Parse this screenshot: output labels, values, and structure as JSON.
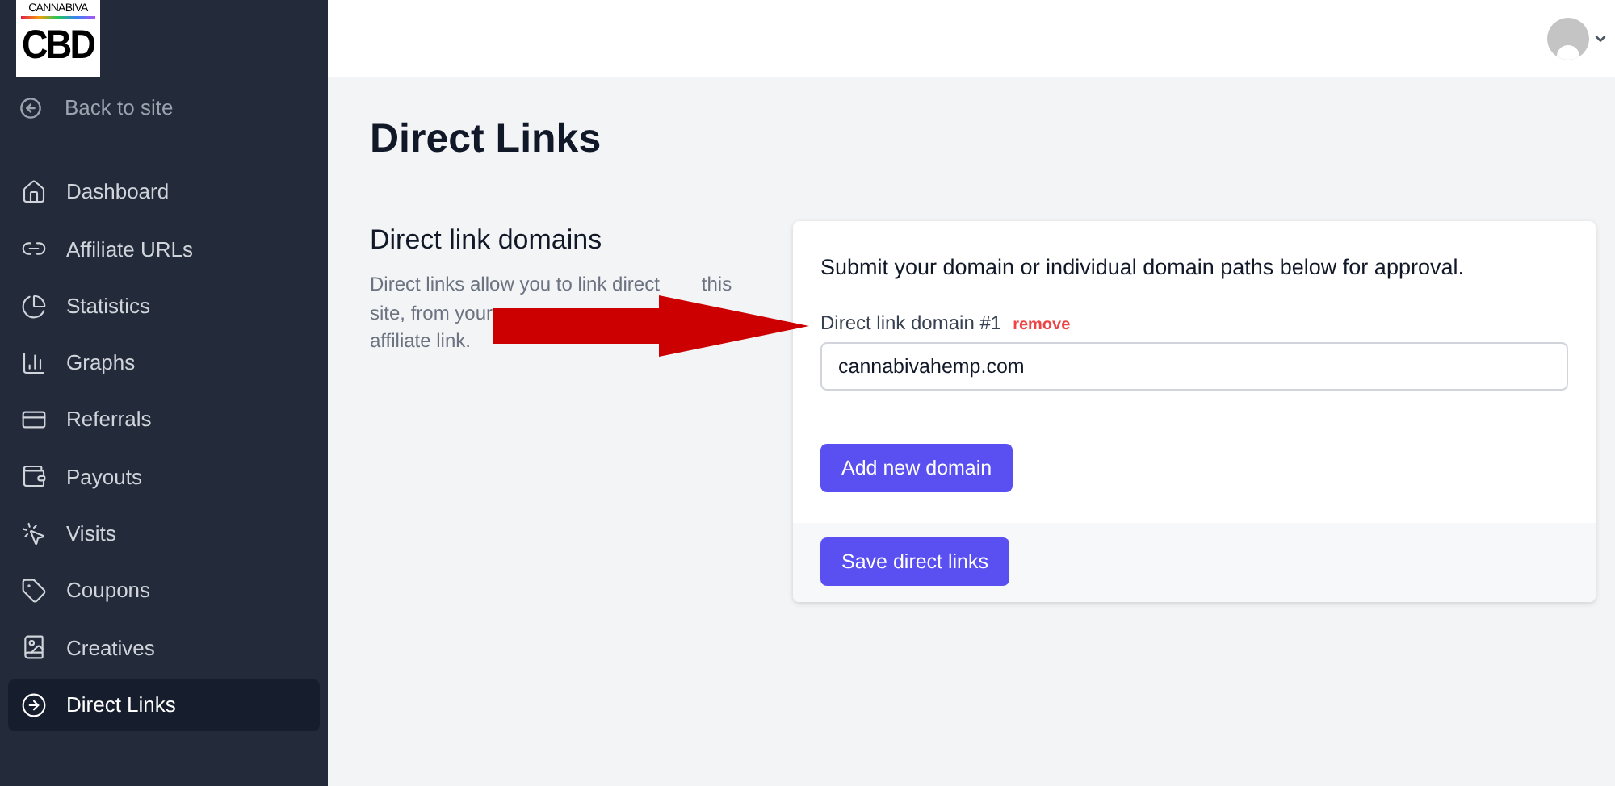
{
  "logo": {
    "top": "CANNABIVA",
    "main": "CBD"
  },
  "back_link": "Back to site",
  "sidebar": {
    "items": [
      {
        "label": "Dashboard",
        "selected": false
      },
      {
        "label": "Affiliate URLs",
        "selected": false
      },
      {
        "label": "Statistics",
        "selected": false
      },
      {
        "label": "Graphs",
        "selected": false
      },
      {
        "label": "Referrals",
        "selected": false
      },
      {
        "label": "Payouts",
        "selected": false
      },
      {
        "label": "Visits",
        "selected": false
      },
      {
        "label": "Coupons",
        "selected": false
      },
      {
        "label": "Creatives",
        "selected": false
      },
      {
        "label": "Direct Links",
        "selected": true
      }
    ]
  },
  "page_title": "Direct Links",
  "section": {
    "title": "Direct link domains",
    "description_lines": [
      [
        "Direct links allow you to link direct",
        "this"
      ],
      [
        "site, from your"
      ],
      [
        "affiliate link."
      ]
    ]
  },
  "card": {
    "intro": "Submit your domain or individual domain paths below for approval.",
    "domains": [
      {
        "label": "Direct link domain #1",
        "remove": "remove",
        "value": "cannabivahemp.com"
      }
    ],
    "add_button": "Add new domain",
    "save_button": "Save direct links"
  }
}
